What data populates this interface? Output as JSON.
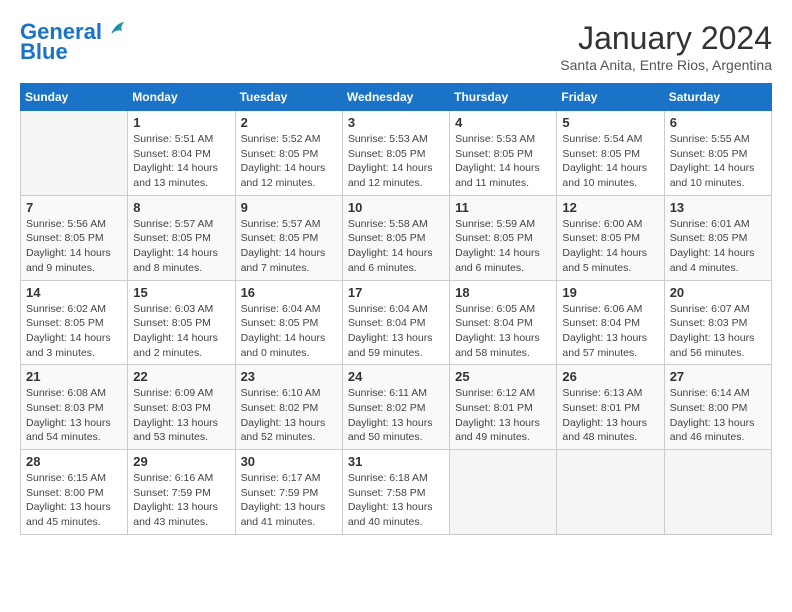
{
  "header": {
    "logo_line1": "General",
    "logo_line2": "Blue",
    "month": "January 2024",
    "location": "Santa Anita, Entre Rios, Argentina"
  },
  "columns": [
    "Sunday",
    "Monday",
    "Tuesday",
    "Wednesday",
    "Thursday",
    "Friday",
    "Saturday"
  ],
  "weeks": [
    [
      {
        "day": "",
        "info": ""
      },
      {
        "day": "1",
        "info": "Sunrise: 5:51 AM\nSunset: 8:04 PM\nDaylight: 14 hours\nand 13 minutes."
      },
      {
        "day": "2",
        "info": "Sunrise: 5:52 AM\nSunset: 8:05 PM\nDaylight: 14 hours\nand 12 minutes."
      },
      {
        "day": "3",
        "info": "Sunrise: 5:53 AM\nSunset: 8:05 PM\nDaylight: 14 hours\nand 12 minutes."
      },
      {
        "day": "4",
        "info": "Sunrise: 5:53 AM\nSunset: 8:05 PM\nDaylight: 14 hours\nand 11 minutes."
      },
      {
        "day": "5",
        "info": "Sunrise: 5:54 AM\nSunset: 8:05 PM\nDaylight: 14 hours\nand 10 minutes."
      },
      {
        "day": "6",
        "info": "Sunrise: 5:55 AM\nSunset: 8:05 PM\nDaylight: 14 hours\nand 10 minutes."
      }
    ],
    [
      {
        "day": "7",
        "info": "Sunrise: 5:56 AM\nSunset: 8:05 PM\nDaylight: 14 hours\nand 9 minutes."
      },
      {
        "day": "8",
        "info": "Sunrise: 5:57 AM\nSunset: 8:05 PM\nDaylight: 14 hours\nand 8 minutes."
      },
      {
        "day": "9",
        "info": "Sunrise: 5:57 AM\nSunset: 8:05 PM\nDaylight: 14 hours\nand 7 minutes."
      },
      {
        "day": "10",
        "info": "Sunrise: 5:58 AM\nSunset: 8:05 PM\nDaylight: 14 hours\nand 6 minutes."
      },
      {
        "day": "11",
        "info": "Sunrise: 5:59 AM\nSunset: 8:05 PM\nDaylight: 14 hours\nand 6 minutes."
      },
      {
        "day": "12",
        "info": "Sunrise: 6:00 AM\nSunset: 8:05 PM\nDaylight: 14 hours\nand 5 minutes."
      },
      {
        "day": "13",
        "info": "Sunrise: 6:01 AM\nSunset: 8:05 PM\nDaylight: 14 hours\nand 4 minutes."
      }
    ],
    [
      {
        "day": "14",
        "info": "Sunrise: 6:02 AM\nSunset: 8:05 PM\nDaylight: 14 hours\nand 3 minutes."
      },
      {
        "day": "15",
        "info": "Sunrise: 6:03 AM\nSunset: 8:05 PM\nDaylight: 14 hours\nand 2 minutes."
      },
      {
        "day": "16",
        "info": "Sunrise: 6:04 AM\nSunset: 8:05 PM\nDaylight: 14 hours\nand 0 minutes."
      },
      {
        "day": "17",
        "info": "Sunrise: 6:04 AM\nSunset: 8:04 PM\nDaylight: 13 hours\nand 59 minutes."
      },
      {
        "day": "18",
        "info": "Sunrise: 6:05 AM\nSunset: 8:04 PM\nDaylight: 13 hours\nand 58 minutes."
      },
      {
        "day": "19",
        "info": "Sunrise: 6:06 AM\nSunset: 8:04 PM\nDaylight: 13 hours\nand 57 minutes."
      },
      {
        "day": "20",
        "info": "Sunrise: 6:07 AM\nSunset: 8:03 PM\nDaylight: 13 hours\nand 56 minutes."
      }
    ],
    [
      {
        "day": "21",
        "info": "Sunrise: 6:08 AM\nSunset: 8:03 PM\nDaylight: 13 hours\nand 54 minutes."
      },
      {
        "day": "22",
        "info": "Sunrise: 6:09 AM\nSunset: 8:03 PM\nDaylight: 13 hours\nand 53 minutes."
      },
      {
        "day": "23",
        "info": "Sunrise: 6:10 AM\nSunset: 8:02 PM\nDaylight: 13 hours\nand 52 minutes."
      },
      {
        "day": "24",
        "info": "Sunrise: 6:11 AM\nSunset: 8:02 PM\nDaylight: 13 hours\nand 50 minutes."
      },
      {
        "day": "25",
        "info": "Sunrise: 6:12 AM\nSunset: 8:01 PM\nDaylight: 13 hours\nand 49 minutes."
      },
      {
        "day": "26",
        "info": "Sunrise: 6:13 AM\nSunset: 8:01 PM\nDaylight: 13 hours\nand 48 minutes."
      },
      {
        "day": "27",
        "info": "Sunrise: 6:14 AM\nSunset: 8:00 PM\nDaylight: 13 hours\nand 46 minutes."
      }
    ],
    [
      {
        "day": "28",
        "info": "Sunrise: 6:15 AM\nSunset: 8:00 PM\nDaylight: 13 hours\nand 45 minutes."
      },
      {
        "day": "29",
        "info": "Sunrise: 6:16 AM\nSunset: 7:59 PM\nDaylight: 13 hours\nand 43 minutes."
      },
      {
        "day": "30",
        "info": "Sunrise: 6:17 AM\nSunset: 7:59 PM\nDaylight: 13 hours\nand 41 minutes."
      },
      {
        "day": "31",
        "info": "Sunrise: 6:18 AM\nSunset: 7:58 PM\nDaylight: 13 hours\nand 40 minutes."
      },
      {
        "day": "",
        "info": ""
      },
      {
        "day": "",
        "info": ""
      },
      {
        "day": "",
        "info": ""
      }
    ]
  ]
}
